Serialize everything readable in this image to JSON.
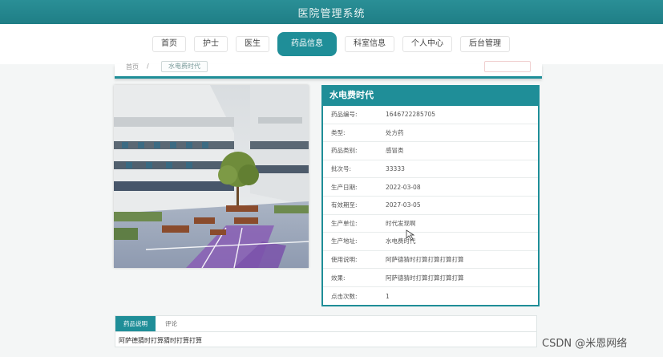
{
  "header": {
    "title": "医院管理系统"
  },
  "nav": {
    "items": [
      {
        "label": "首页"
      },
      {
        "label": "护士"
      },
      {
        "label": "医生"
      },
      {
        "label": "药品信息"
      },
      {
        "label": "科室信息"
      },
      {
        "label": "个人中心"
      },
      {
        "label": "后台管理"
      }
    ],
    "active_index": 3
  },
  "breadcrumb": {
    "home": "首页",
    "separator": "/",
    "current": "水电费时代",
    "action": ""
  },
  "detail": {
    "title": "水电费时代",
    "fields": [
      {
        "label": "药品编号:",
        "value": "1646722285705"
      },
      {
        "label": "类型:",
        "value": "处方药"
      },
      {
        "label": "药品类别:",
        "value": "感冒类"
      },
      {
        "label": "批次号:",
        "value": "33333"
      },
      {
        "label": "生产日期:",
        "value": "2022-03-08"
      },
      {
        "label": "有效期至:",
        "value": "2027-03-05"
      },
      {
        "label": "生产单位:",
        "value": "时代发现啊"
      },
      {
        "label": "生产地址:",
        "value": "水电费时代"
      },
      {
        "label": "使用说明:",
        "value": "阿萨德猜时打算打算打算打算"
      },
      {
        "label": "效果:",
        "value": "阿萨德猜时打算打算打算打算"
      },
      {
        "label": "点击次数:",
        "value": "1"
      }
    ]
  },
  "tabs": {
    "items": [
      {
        "label": "药品说明"
      },
      {
        "label": "评论"
      }
    ],
    "content": "阿萨德猜时打算猜时打算打算"
  },
  "watermark": "CSDN @米恩网络",
  "colors": {
    "accent": "#1f8e98",
    "header": "#23868e"
  }
}
